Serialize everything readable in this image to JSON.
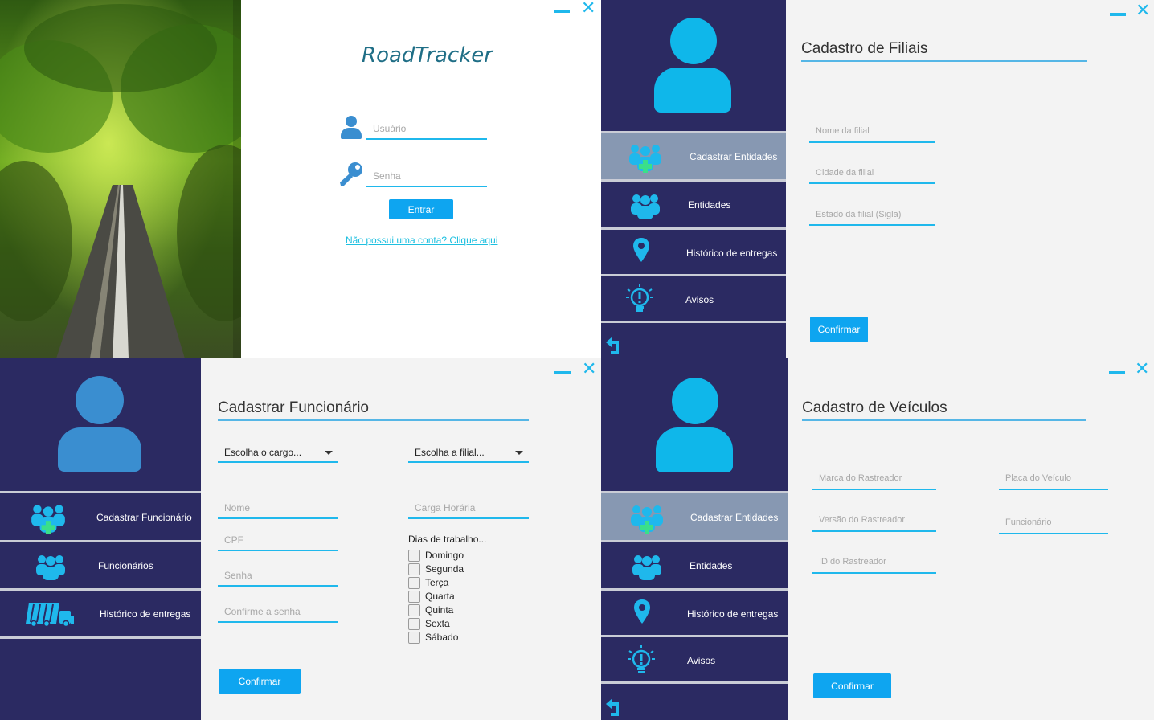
{
  "login": {
    "app_title": "RoadTracker",
    "username_placeholder": "Usuário",
    "password_placeholder": "Senha",
    "login_button": "Entrar",
    "signup_link": "Não possui uma conta? Clique aqui"
  },
  "filiais": {
    "nav": [
      {
        "label": "Cadastrar Entidades",
        "icon": "add-group-icon",
        "active": true
      },
      {
        "label": "Entidades",
        "icon": "group-icon",
        "active": false
      },
      {
        "label": "Histórico de entregas",
        "icon": "map-pin-icon",
        "active": false
      },
      {
        "label": "Avisos",
        "icon": "lightbulb-icon",
        "active": false
      }
    ],
    "title": "Cadastro de Filiais",
    "fields": [
      "Nome da filial",
      "Cidade da filial",
      "Estado da filial (Sigla)"
    ],
    "confirm": "Confirmar"
  },
  "funcionario": {
    "nav": [
      {
        "label": "Cadastrar Funcionário",
        "icon": "add-group-icon"
      },
      {
        "label": "Funcionários",
        "icon": "group-icon"
      },
      {
        "label": "Histórico de entregas",
        "icon": "truck-icon"
      }
    ],
    "title": "Cadastrar Funcionário",
    "cargo_select": "Escolha o cargo...",
    "filial_select": "Escolha a filial...",
    "fields_left": [
      "Nome",
      "CPF",
      "Senha",
      "Confirme a senha"
    ],
    "carga_horaria": "Carga Horária",
    "dias_label": "Dias de trabalho...",
    "dias": [
      "Domingo",
      "Segunda",
      "Terça",
      "Quarta",
      "Quinta",
      "Sexta",
      "Sábado"
    ],
    "confirm": "Confirmar"
  },
  "veiculos": {
    "nav": [
      {
        "label": "Cadastrar Entidades",
        "icon": "add-group-icon",
        "active": true
      },
      {
        "label": "Entidades",
        "icon": "group-icon",
        "active": false
      },
      {
        "label": "Histórico de entregas",
        "icon": "map-pin-icon",
        "active": false
      },
      {
        "label": "Avisos",
        "icon": "lightbulb-icon",
        "active": false
      }
    ],
    "title": "Cadastro de Veículos",
    "fields_left": [
      "Marca do Rastreador",
      "Versão do Rastreador",
      "ID do Rastreador"
    ],
    "fields_right": [
      "Placa do Veículo",
      "Funcionário"
    ],
    "confirm": "Confirmar"
  },
  "colors": {
    "sidebar": "#2b2a62",
    "accent": "#1fb8ec",
    "active_nav": "#8798b2",
    "button": "#0ea5f0"
  }
}
